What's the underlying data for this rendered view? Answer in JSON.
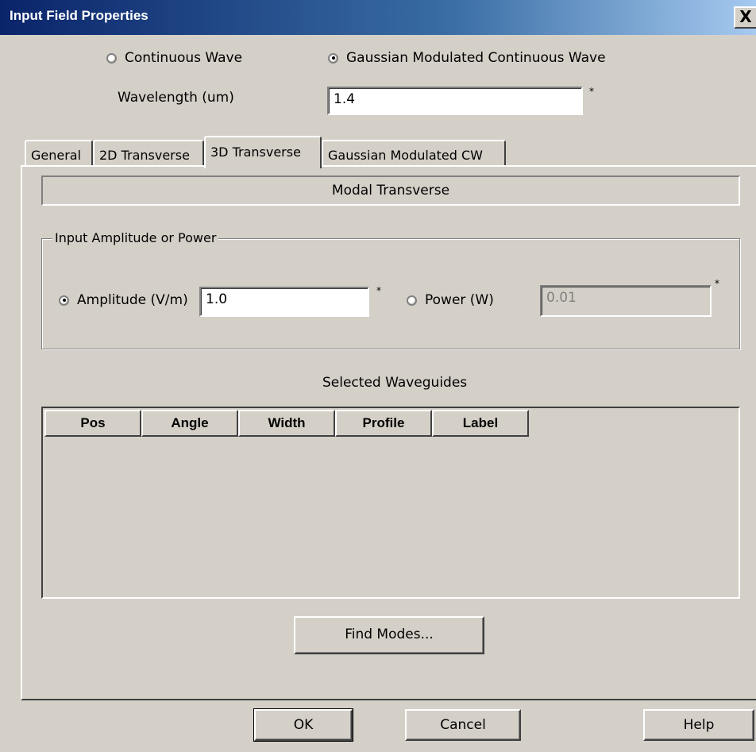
{
  "window": {
    "title": "Input Field Properties",
    "close_glyph": "X"
  },
  "wave_type": {
    "options": [
      {
        "label": "Continuous Wave",
        "selected": false
      },
      {
        "label": "Gaussian Modulated Continuous Wave",
        "selected": true
      }
    ]
  },
  "wavelength": {
    "label": "Wavelength (um)",
    "value": "1.4",
    "required_mark": "*"
  },
  "tabs": [
    {
      "label": "General",
      "active": false
    },
    {
      "label": "2D Transverse",
      "active": false
    },
    {
      "label": "3D Transverse",
      "active": true
    },
    {
      "label": "Gaussian Modulated CW",
      "active": false
    }
  ],
  "panel": {
    "mode_label": "Modal Transverse",
    "group_title": "Input Amplitude or Power",
    "amplitude": {
      "label": "Amplitude (V/m)",
      "value": "1.0",
      "selected": true,
      "required_mark": "*"
    },
    "power": {
      "label": "Power (W)",
      "value": "0.01",
      "selected": false,
      "disabled": true,
      "required_mark": "*"
    },
    "waveguides_title": "Selected Waveguides",
    "columns": [
      "Pos",
      "Angle",
      "Width",
      "Profile",
      "Label"
    ],
    "rows": [],
    "find_modes_label": "Find Modes..."
  },
  "buttons": {
    "ok": "OK",
    "cancel": "Cancel",
    "help": "Help"
  },
  "colors": {
    "face": "#d4d0c8",
    "title_start": "#0a246a",
    "title_end": "#a6caf0"
  }
}
